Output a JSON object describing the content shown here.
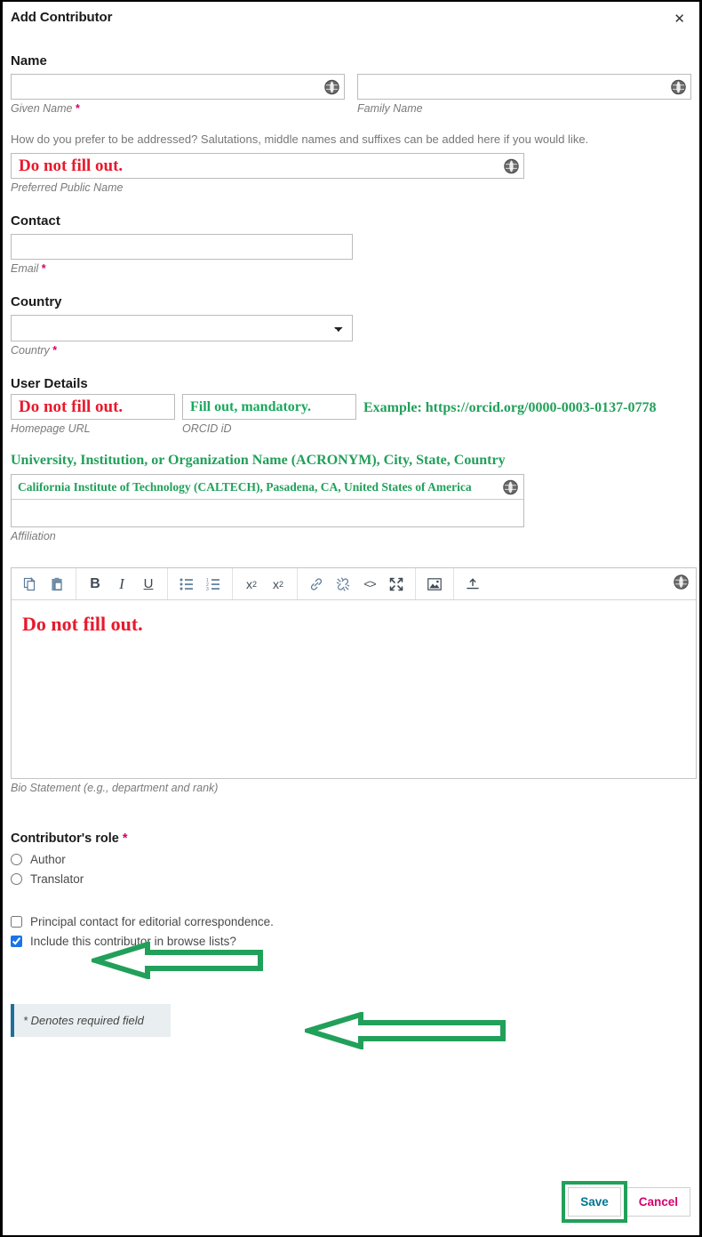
{
  "header": {
    "title": "Add Contributor",
    "close_icon": "close-icon"
  },
  "sections": {
    "name": {
      "legend": "Name",
      "given_name": {
        "label": "Given Name",
        "required": true,
        "value": "",
        "icon": "globe-icon"
      },
      "family_name": {
        "label": "Family Name",
        "required": false,
        "value": "",
        "icon": "globe-icon"
      },
      "helper": "How do you prefer to be addressed? Salutations, middle names and suffixes can be added here if you would like.",
      "preferred_name": {
        "label": "Preferred Public Name",
        "required": false,
        "value": "Do not fill out.",
        "icon": "globe-icon"
      }
    },
    "contact": {
      "legend": "Contact",
      "email": {
        "label": "Email",
        "required": true,
        "value": "",
        "placeholder": ""
      }
    },
    "country": {
      "legend": "Country",
      "select": {
        "label": "Country",
        "required": true,
        "selected": "",
        "options": [
          ""
        ]
      }
    },
    "user_details": {
      "legend": "User Details",
      "homepage": {
        "label": "Homepage URL",
        "value": "Do not fill out."
      },
      "orcid": {
        "label": "ORCID iD",
        "value": "Fill out, mandatory."
      },
      "orcid_example": "Example: https://orcid.org/0000-0003-0137-0778",
      "affiliation_hint": "University, Institution, or Organization Name (ACRONYM), City, State, Country",
      "affiliation": {
        "label": "Affiliation",
        "value": "California Institute of Technology (CALTECH), Pasadena, CA, United States of America",
        "icon": "globe-icon"
      }
    },
    "bio": {
      "label": "Bio Statement (e.g., department and rank)",
      "content": "Do not fill out.",
      "toolbar": [
        {
          "name": "copy-icon",
          "title": "Copy"
        },
        {
          "name": "paste-icon",
          "title": "Paste"
        },
        {
          "name": "bold-icon",
          "title": "Bold",
          "glyph": "B"
        },
        {
          "name": "italic-icon",
          "title": "Italic",
          "glyph": "I"
        },
        {
          "name": "underline-icon",
          "title": "Underline",
          "glyph": "U"
        },
        {
          "name": "bullet-list-icon",
          "title": "Bulleted list"
        },
        {
          "name": "numbered-list-icon",
          "title": "Numbered list"
        },
        {
          "name": "superscript-icon",
          "title": "Superscript"
        },
        {
          "name": "subscript-icon",
          "title": "Subscript"
        },
        {
          "name": "link-icon",
          "title": "Insert link"
        },
        {
          "name": "unlink-icon",
          "title": "Remove link"
        },
        {
          "name": "code-icon",
          "title": "Source code"
        },
        {
          "name": "fullscreen-icon",
          "title": "Fullscreen"
        },
        {
          "name": "image-icon",
          "title": "Insert image"
        },
        {
          "name": "upload-icon",
          "title": "Upload"
        }
      ],
      "globe_icon": "globe-icon"
    },
    "role": {
      "legend": "Contributor's role",
      "required": true,
      "options": [
        {
          "label": "Author",
          "checked": false
        },
        {
          "label": "Translator",
          "checked": false
        }
      ]
    },
    "flags": [
      {
        "label": "Principal contact for editorial correspondence.",
        "checked": false
      },
      {
        "label": "Include this contributor in browse lists?",
        "checked": true
      }
    ],
    "notice": "* Denotes required field"
  },
  "footer": {
    "save_label": "Save",
    "cancel_label": "Cancel"
  },
  "annotations": {
    "arrow_role": "green-arrow-pointing-to-author",
    "arrow_principal_contact": "green-arrow-pointing-to-principal-contact",
    "save_highlight": "green-box-around-save"
  },
  "colors": {
    "red": "#e8192c",
    "green": "#21a05a",
    "pink": "#d4006e",
    "teal": "#00758f",
    "blue": "#1a73e8"
  }
}
